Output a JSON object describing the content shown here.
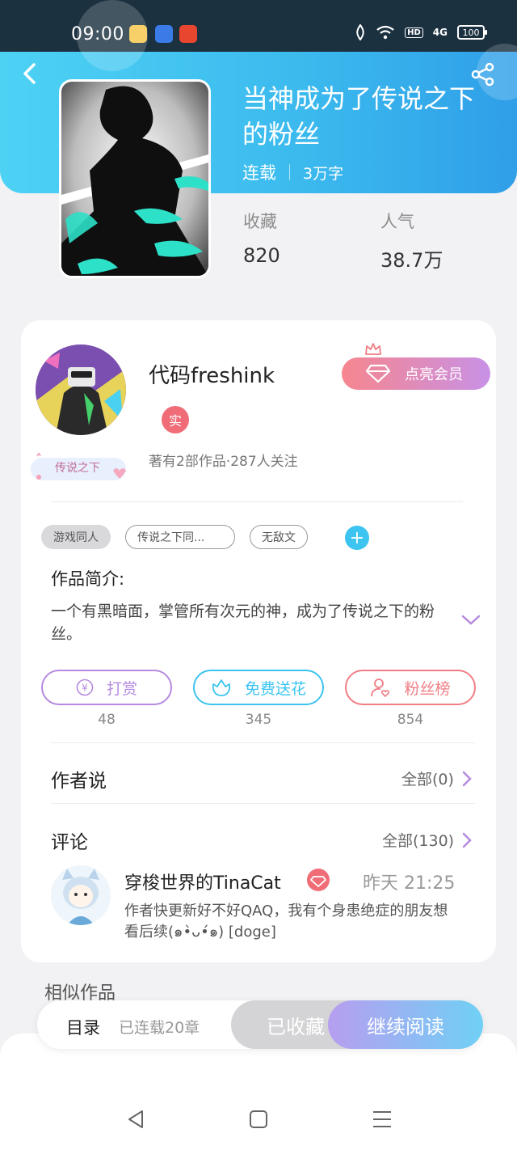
{
  "status_bar": {
    "time": "09:00",
    "network": "4G",
    "hd": "HD",
    "battery": "100"
  },
  "book": {
    "title": "当神成为了传说之下的粉丝",
    "status": "连载",
    "word_count": "3万字",
    "collect_label": "收藏",
    "collect_value": "820",
    "popularity_label": "人气",
    "popularity_value": "38.7万"
  },
  "author": {
    "name": "代码freshink",
    "verified_badge": "实",
    "stats": "著有2部作品·287人关注",
    "badge_text": "传说之下",
    "vip_button": "点亮会员"
  },
  "tags": [
    "游戏同人",
    "传说之下同...",
    "无敌文"
  ],
  "tag_add": "+",
  "intro": {
    "title": "作品简介:",
    "text": "一个有黑暗面，掌管所有次元的神，成为了传说之下的粉丝。"
  },
  "actions": [
    {
      "label": "打赏",
      "count": "48",
      "color": "#b58ae0"
    },
    {
      "label": "免费送花",
      "count": "345",
      "color": "#3cc4ef"
    },
    {
      "label": "粉丝榜",
      "count": "854",
      "color": "#f07d85"
    }
  ],
  "author_says": {
    "title": "作者说",
    "link": "全部(0)"
  },
  "comments": {
    "title": "评论",
    "link": "全部(130)",
    "items": [
      {
        "user": "穿梭世界的TinaCat",
        "time": "昨天 21:25",
        "text": "作者快更新好不好QAQ，我有个身患绝症的朋友想看后续(๑•̀ᴗ•́๑) [doge]"
      }
    ]
  },
  "similar_title": "相似作品",
  "bottom_bar": {
    "toc": "目录",
    "chapters": "已连载20章",
    "collected": "已收藏",
    "continue": "继续阅读"
  },
  "colors": {
    "header_start": "#4dd2f4",
    "header_end": "#2f9fe8",
    "accent_pink": "#f06d78",
    "accent_purple": "#b58ae0",
    "accent_cyan": "#3cc4ef"
  }
}
